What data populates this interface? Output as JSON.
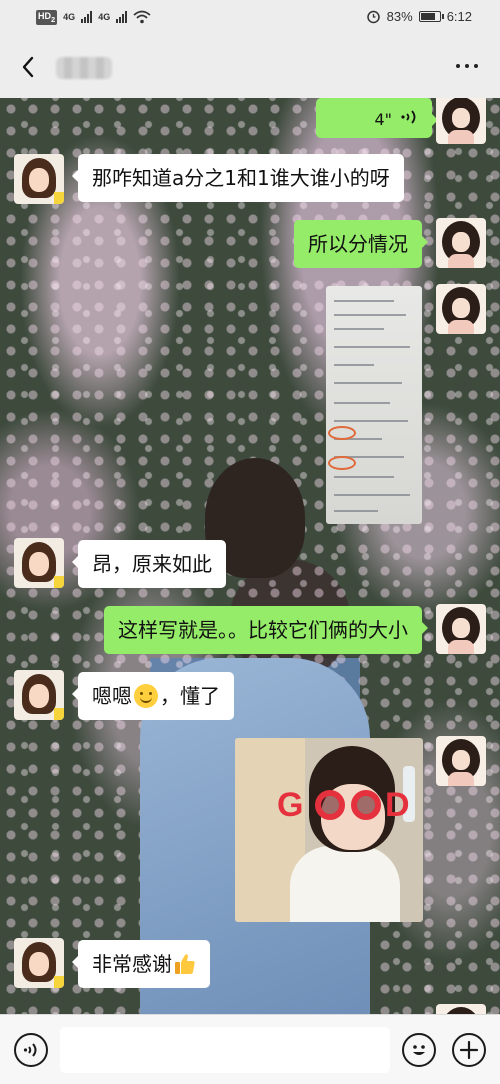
{
  "status_bar": {
    "hd_label": "HD",
    "hd_sub": "2",
    "network_1": "4G",
    "network_2": "4G",
    "battery_percent": "83%",
    "battery_level": 0.83,
    "time": "6:12"
  },
  "header": {
    "contact_name": "",
    "back_icon": "back-chevron-icon",
    "more_icon": "more-dots-icon"
  },
  "messages": [
    {
      "side": "out",
      "type": "voice",
      "duration": "4\""
    },
    {
      "side": "in",
      "type": "text",
      "text": "那咋知道a分之1和1谁大谁小的呀"
    },
    {
      "side": "out",
      "type": "text",
      "text": "所以分情况"
    },
    {
      "side": "out",
      "type": "image",
      "description_icon": "handwritten-notes-photo"
    },
    {
      "side": "in",
      "type": "text",
      "text": "昂，原来如此"
    },
    {
      "side": "out",
      "type": "text",
      "text": "这样写就是。。比较它们俩的大小"
    },
    {
      "side": "in",
      "type": "text",
      "text_before": "嗯嗯",
      "text_after": "，懂了",
      "emoji": "smile-emoji"
    },
    {
      "side": "out",
      "type": "image",
      "description_icon": "good-sticker-photo",
      "sticker_text_left": "G",
      "sticker_text_right": "D"
    },
    {
      "side": "in",
      "type": "text",
      "text": "非常感谢",
      "emoji": "thumbs-up-emoji"
    }
  ],
  "input_bar": {
    "placeholder": "",
    "voice_icon": "voice-toggle-icon",
    "emoji_icon": "emoji-icon",
    "plus_icon": "plus-icon"
  },
  "colors": {
    "outgoing_bubble": "#95ec69",
    "incoming_bubble": "#ffffff",
    "background": "#ededed"
  }
}
